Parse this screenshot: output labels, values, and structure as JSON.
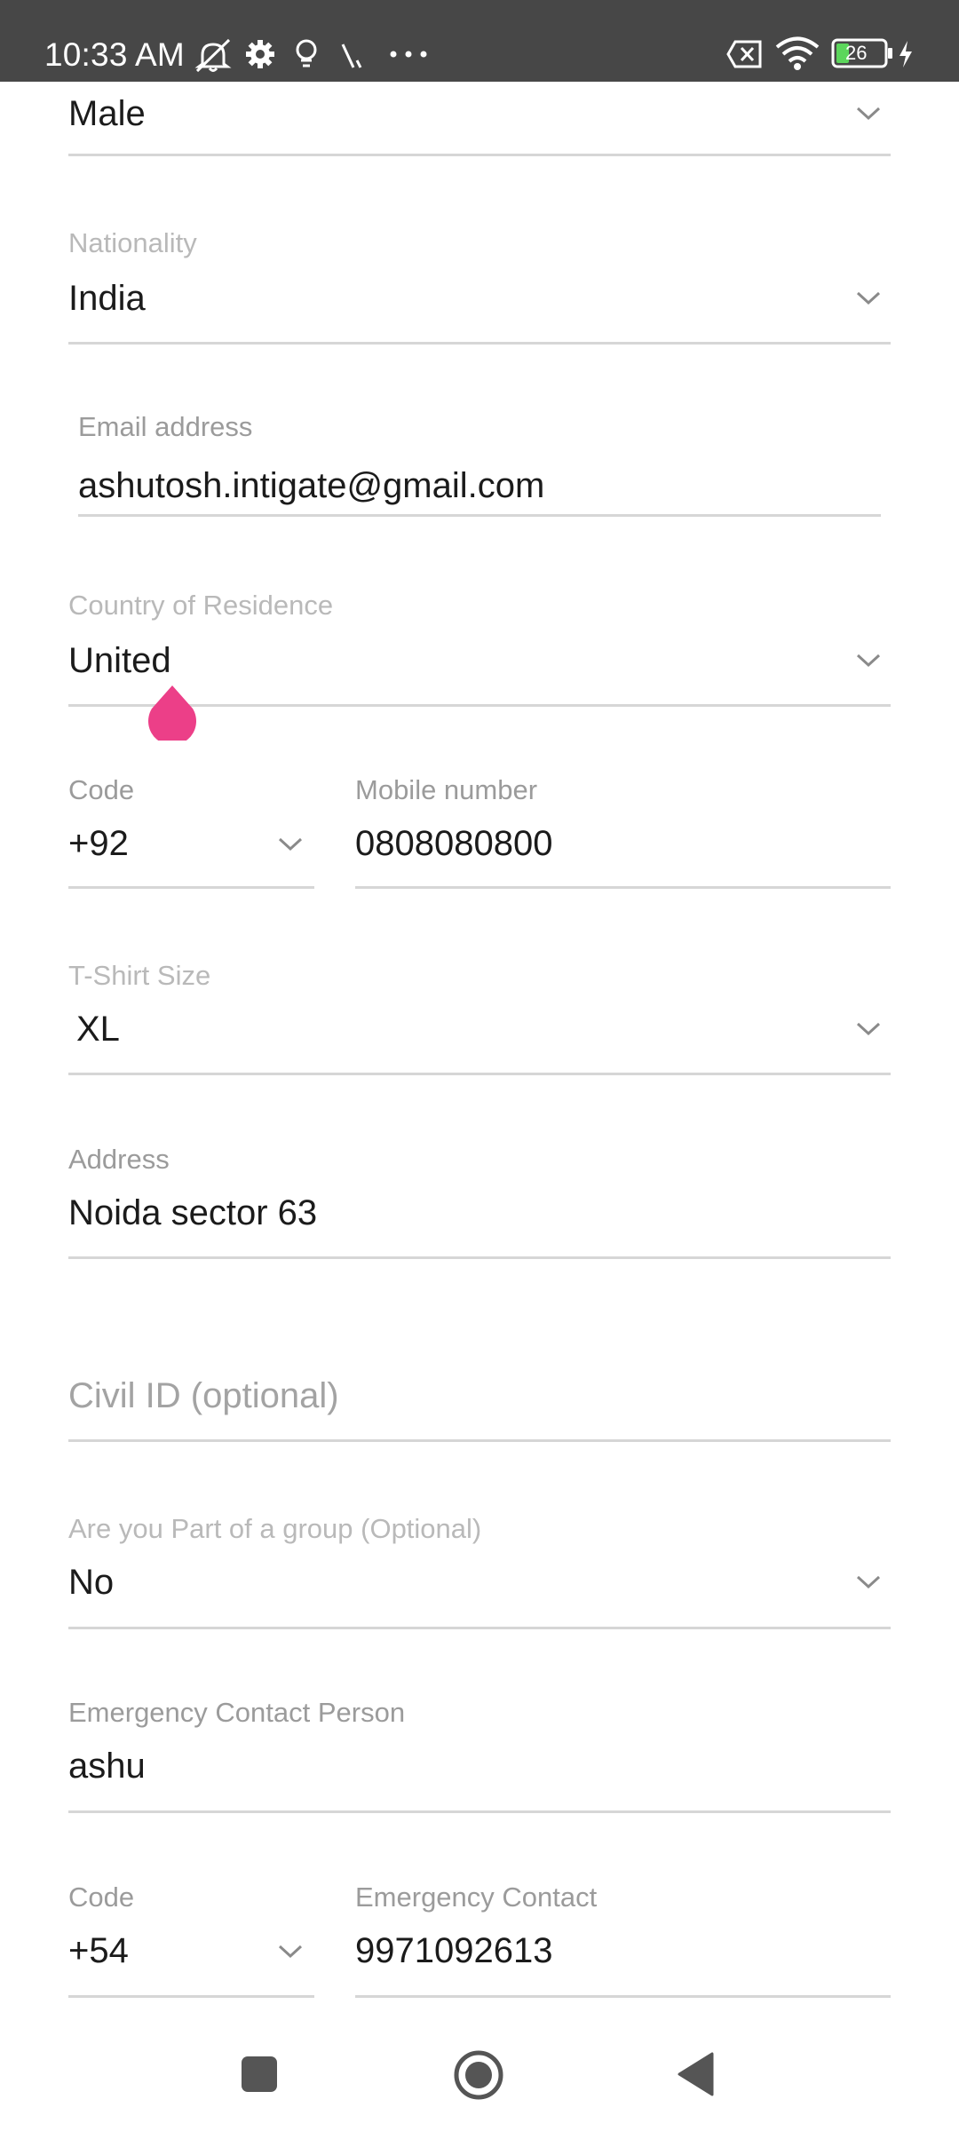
{
  "status_bar": {
    "time": "10:33 AM",
    "battery_level": "26"
  },
  "form": {
    "gender": {
      "value": "Male"
    },
    "nationality": {
      "label": "Nationality",
      "value": "India"
    },
    "email": {
      "label": "Email address",
      "value": "ashutosh.intigate@gmail.com"
    },
    "country_of_residence": {
      "label": "Country of Residence",
      "value": "United"
    },
    "mobile_code": {
      "label": "Code",
      "value": "+92"
    },
    "mobile_number": {
      "label": "Mobile number",
      "value": "0808080800"
    },
    "tshirt_size": {
      "label": "T-Shirt Size",
      "value": "XL"
    },
    "address": {
      "label": "Address",
      "value": "Noida sector 63"
    },
    "civil_id": {
      "placeholder": "Civil ID (optional)"
    },
    "group": {
      "label": "Are you Part of a group (Optional)",
      "value": "No"
    },
    "emergency_contact_person": {
      "label": "Emergency Contact Person",
      "value": "ashu"
    },
    "emergency_code": {
      "label": "Code",
      "value": "+54"
    },
    "emergency_contact": {
      "label": "Emergency Contact",
      "value": "9971092613"
    }
  },
  "colors": {
    "status_bar_bg": "#474747",
    "label": "#9b9b9b",
    "value_text": "#1b1b1b",
    "underline": "#d6d6d6",
    "cursor_handle": "#ec3f88",
    "battery_fill": "#5cd65c"
  },
  "icons": {
    "status": [
      "mute-icon",
      "settings-icon",
      "location-icon",
      "slash-icon",
      "more-icon",
      "sim-cross-icon",
      "wifi-icon",
      "battery-icon",
      "charging-icon"
    ],
    "nav": [
      "recents-button",
      "home-button",
      "back-button"
    ]
  }
}
